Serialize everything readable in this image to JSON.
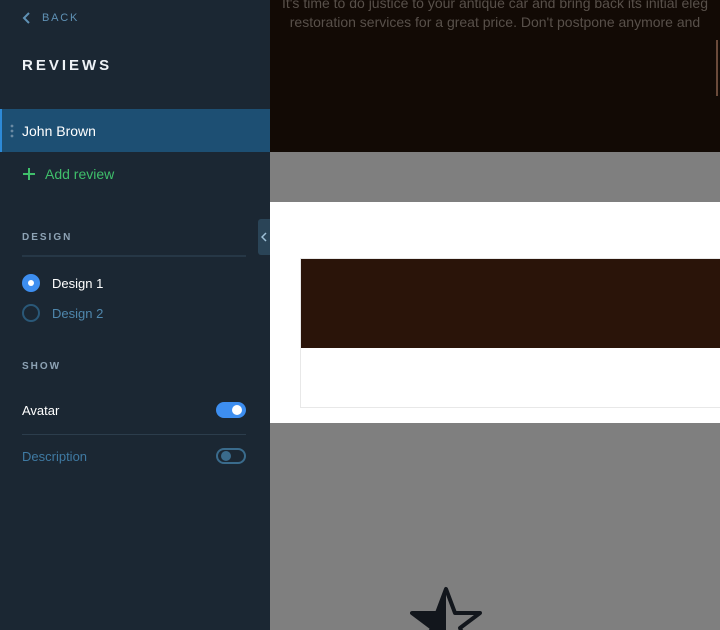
{
  "sidebar": {
    "back_label": "BACK",
    "title": "REVIEWS",
    "reviews": [
      {
        "name": "John Brown",
        "selected": true
      }
    ],
    "add_review_label": "Add review",
    "design": {
      "section_label": "DESIGN",
      "options": [
        {
          "label": "Design 1",
          "selected": true
        },
        {
          "label": "Design 2",
          "selected": false
        }
      ]
    },
    "show": {
      "section_label": "SHOW",
      "toggles": [
        {
          "label": "Avatar",
          "on": true
        },
        {
          "label": "Description",
          "on": false
        }
      ]
    }
  },
  "preview": {
    "hero_text_line1": "It's time to do justice to your antique car and bring back its initial eleg",
    "hero_text_line2": "restoration services for a great price. Don't postpone anymore and"
  },
  "colors": {
    "sidebar_bg": "#1b2733",
    "selected_item": "#1d4f73",
    "accent_blue": "#3d8ef0",
    "add_green": "#3fbf6b"
  },
  "icons": [
    "chevron-left-icon",
    "drag-handle-icon",
    "plus-icon",
    "collapse-chevron-icon",
    "star-icon"
  ]
}
